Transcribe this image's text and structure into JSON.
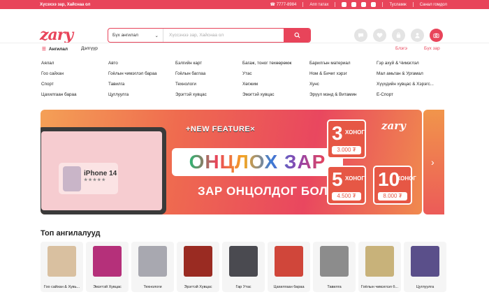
{
  "topbar": {
    "left": "Хүсэхээ зар, Хайснаа ол",
    "phone": "7777-8984",
    "app": "Апп татах",
    "help": "Тусламж",
    "feedback": "Санал гомдол"
  },
  "header": {
    "logo": "zary",
    "search_category": "Бүх ангилал",
    "search_placeholder": "Хүссэнээ зар, Хайснаа ол"
  },
  "nav": {
    "menu": "Ангилал",
    "sub": "Дэлгүүр",
    "right1": "Блэгэ",
    "right2": "Бүх зар"
  },
  "categories": [
    "Аялал",
    "Авто",
    "Бэлгийн карт",
    "Багаж, тоног төхөөрөмж",
    "Барилгын материал",
    "Гэр ахуй & Чимэглэл",
    "Гоо сайхан",
    "Гоёлын чимэглэл бараа",
    "Гоёлын баглаа",
    "Утас",
    "Ном & Бичиг хэрэг",
    "Мал амьтан & Ургамал",
    "Спорт",
    "Тавилга",
    "Технологи",
    "Хөгжим",
    "Хунс",
    "Хүүхдийн хувцас & Хэрэгс...",
    "Цахилгаан бараа",
    "Цуглуулга",
    "Эрэгтэй хувцас",
    "Эмэгтэй хувцас",
    "Эрүүл мэнд & Витамин",
    "E-Спорт"
  ],
  "banner": {
    "new_feature": "+NEW FEATURE×",
    "title": "ОНЦЛОХ ЗАР",
    "subtitle": "ЗАР ОНЦОЛДОГ БОЛЛОО",
    "iphone": "iPhone 14",
    "logo": "zary",
    "packages": [
      {
        "num": "3",
        "label": "ХОНОГ",
        "price": "3.000 ₮"
      },
      {
        "num": "5",
        "label": "ХОНОГ",
        "price": "4.500 ₮"
      },
      {
        "num": "10",
        "label": "ХОНОГ",
        "price": "8.000 ₮"
      }
    ]
  },
  "top": {
    "title": "Топ ангилалууд",
    "items": [
      {
        "label": "Гоо сайхан & Хувь...",
        "color": "#d9c0a0"
      },
      {
        "label": "Эмэгтэй Хувцас",
        "color": "#b5307a"
      },
      {
        "label": "Технологи",
        "color": "#a8a8b0"
      },
      {
        "label": "Эрэгтэй Хувцас",
        "color": "#9a2b22"
      },
      {
        "label": "Гар Утас",
        "color": "#4a4a50"
      },
      {
        "label": "Цахилгаан бараа",
        "color": "#d0463a"
      },
      {
        "label": "Тавилга",
        "color": "#8c8c8c"
      },
      {
        "label": "Гоёлын чимэглэл б...",
        "color": "#c8b27a"
      },
      {
        "label": "Цуглуулга",
        "color": "#5a4f8a"
      }
    ]
  }
}
